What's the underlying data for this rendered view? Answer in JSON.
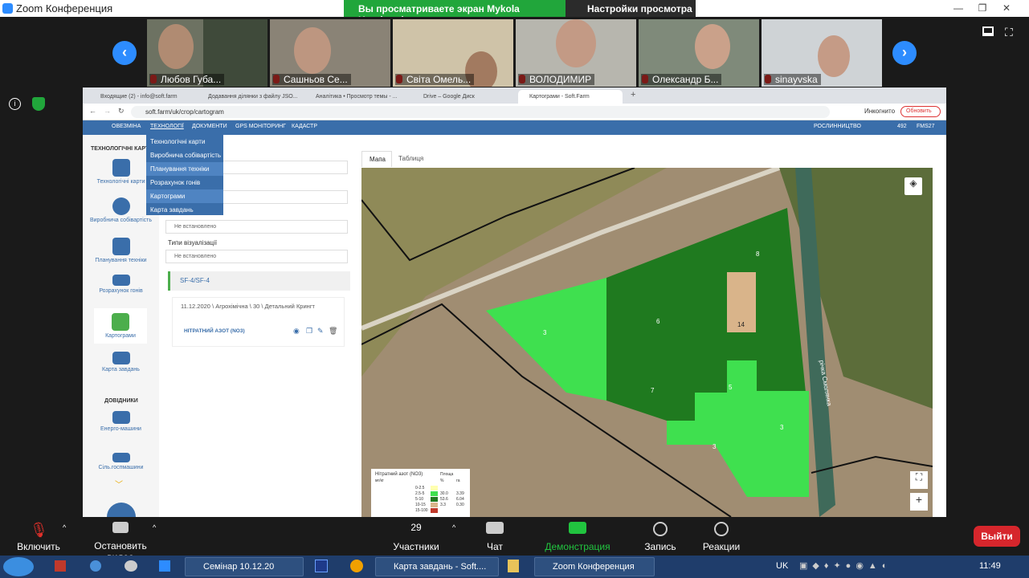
{
  "zoom": {
    "title": "Zoom Конференция",
    "viewing": "Вы просматриваете экран Mykola Kondratuk",
    "view_options": "Настройки просмотра"
  },
  "participants": [
    "Любов Губа...",
    "Сашньов Се...",
    "Світа Омель...",
    "ВОЛОДИМИР",
    "Олександр Б...",
    "sinayvska"
  ],
  "browser": {
    "tabs": [
      "Входящие (2) - info@soft.farm",
      "Додавання ділянки з файлу JSO...",
      "Аналітика • Просмотр темы - ...",
      "Drive – Google Диск",
      "Картограми - Soft.Farm"
    ],
    "url": "soft.farm/uk/crop/cartogram",
    "incognito": "Инкогнито",
    "update": "Обновить"
  },
  "app": {
    "nav": [
      "ОВЕЗМІНА",
      "ТЕХНОЛОГІЇ",
      "ДОКУМЕНТИ",
      "GPS МОНІТОРИНГ",
      "КАДАСТР"
    ],
    "right": {
      "crop": "РОСЛИННИЦТВО",
      "count": "492",
      "user": "FMS27"
    },
    "dropdown": [
      "Технологічні карти",
      "Виробнича собівартість",
      "Планування техніки",
      "Розрахунок гонів",
      "Картограми",
      "Карта завдань"
    ],
    "sidebar_title": "ТЕХНОЛОГІЧНІ КАРТ",
    "sidebar": [
      "Технологічні карти",
      "Виробнича собівартість",
      "Планування техніки",
      "Розрахунок гонів",
      "Картограми",
      "Карта завдань"
    ],
    "sidebar_dovidnyky": "ДОВІДНИКИ",
    "sidebar_more": [
      "Енерго-машини",
      "Сіль.госпмашини"
    ],
    "form": {
      "field_placeholder": "у ділянку",
      "label_type": "Типи візуалізації",
      "not_set": "Не встановлено",
      "group": "SF-4/SF-4",
      "record": "11.12.2020 \\ Агрохімічна \\ 30 \\ Детальний Крингт",
      "layer": "НІТРАТНИЙ АЗОТ (NO3)"
    },
    "map_tabs": [
      "Мапа",
      "Таблиця"
    ],
    "river": "річка Смолянка",
    "zones": [
      "8",
      "6",
      "14",
      "3",
      "7",
      "5",
      "3",
      "3"
    ],
    "legend": {
      "title": "Нітратний азот (NO3)",
      "unit": "мг/кг",
      "area": "Площа",
      "pct": "%",
      "ha": "га",
      "rows": [
        [
          "0-2.5",
          "",
          ""
        ],
        [
          "2.5-5",
          "30.0",
          "3.39"
        ],
        [
          "5-10",
          "53.6",
          "6.04"
        ],
        [
          "10-15",
          "3.3",
          "0.30"
        ],
        [
          "15-100",
          "",
          ""
        ]
      ]
    }
  },
  "controls": {
    "audio": "Включить звук",
    "video": "Остановить видео",
    "participants_count": "29",
    "participants": "Участники",
    "chat": "Чат",
    "share": "Демонстрация экрана",
    "record": "Запись",
    "reactions": "Реакции",
    "leave": "Выйти"
  },
  "taskbar": {
    "items": [
      "Семінар 10.12.20",
      "Карта завдань - Soft....",
      "Zoom Конференция"
    ],
    "lang": "UK",
    "time": "11:49"
  },
  "colors": {
    "zoom_blue": "#2d8cff",
    "share_green": "#21a63b",
    "app_blue": "#3a6eaa",
    "zone_dark": "#1f7a1f",
    "zone_light": "#3fe04f",
    "zone_tan": "#d9b48a",
    "leave_red": "#d6262c"
  }
}
